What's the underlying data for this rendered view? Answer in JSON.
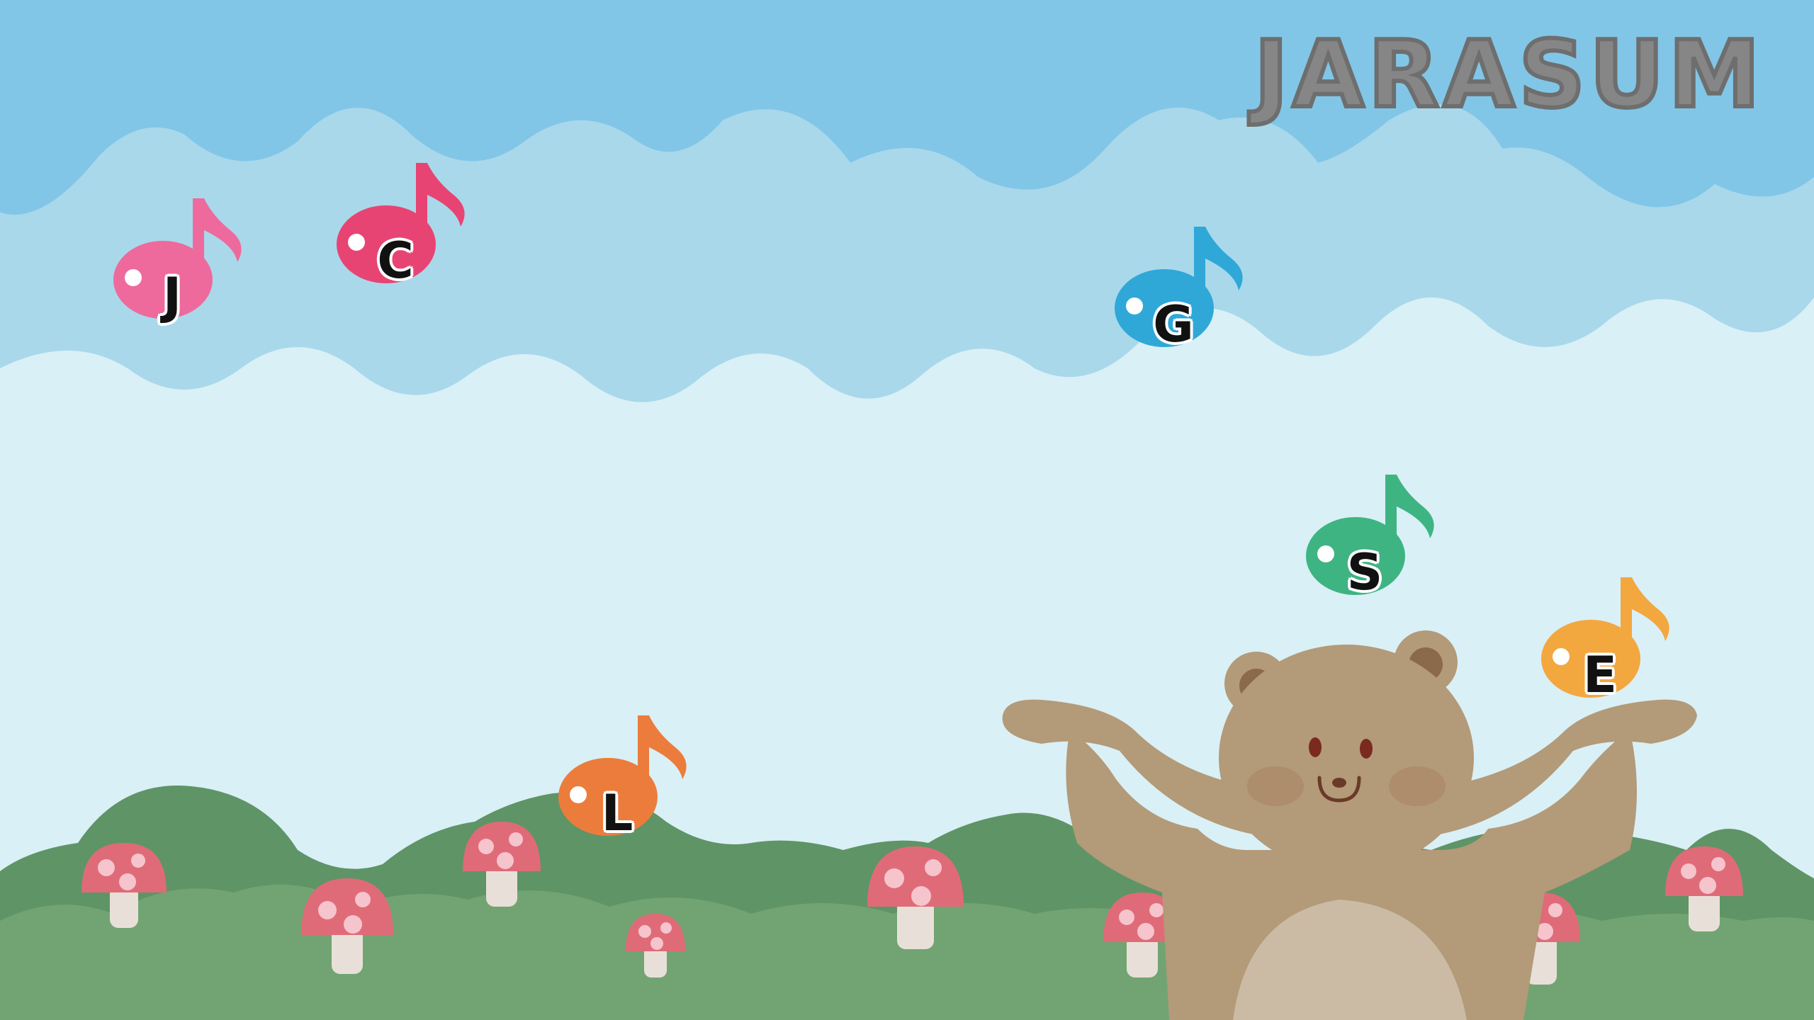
{
  "game": {
    "logo": "JARASUM"
  },
  "notes": [
    {
      "id": "J",
      "letter": "J",
      "color": "#ee6a9c"
    },
    {
      "id": "C",
      "letter": "C",
      "color": "#e84473"
    },
    {
      "id": "G",
      "letter": "G",
      "color": "#2fa8d8"
    },
    {
      "id": "S",
      "letter": "S",
      "color": "#3fb483"
    },
    {
      "id": "E",
      "letter": "E",
      "color": "#f3a73f"
    },
    {
      "id": "L",
      "letter": "L",
      "color": "#ec7c3c"
    }
  ],
  "palette": {
    "sky_top": "#7fc4e6",
    "cloud_band": "#a6d6ea",
    "sky_light": "#d8eff6",
    "hill_dark": "#5f9466",
    "hill_light": "#78a878",
    "bear": "#b39a78",
    "bear_belly": "#cbbba4",
    "mushroom_cap": "#e06b78",
    "mushroom_spot": "#f6c4cc",
    "mushroom_stem": "#e8e0d8"
  }
}
